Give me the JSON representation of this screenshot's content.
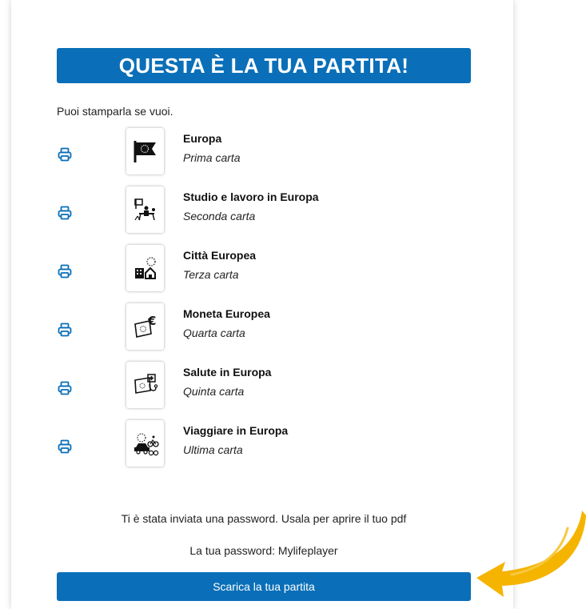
{
  "header": {
    "title": "QUESTA È LA TUA PARTITA!"
  },
  "intro": "Puoi stamparla se vuoi.",
  "cards": [
    {
      "title": "Europa",
      "subtitle": "Prima carta",
      "icon": "eu-flag-icon"
    },
    {
      "title": "Studio e lavoro in Europa",
      "subtitle": "Seconda carta",
      "icon": "study-work-icon"
    },
    {
      "title": "Città Europea",
      "subtitle": "Terza carta",
      "icon": "city-icon"
    },
    {
      "title": "Moneta Europea",
      "subtitle": "Quarta carta",
      "icon": "euro-flag-icon"
    },
    {
      "title": "Salute in Europa",
      "subtitle": "Quinta carta",
      "icon": "health-icon"
    },
    {
      "title": "Viaggiare in Europa",
      "subtitle": "Ultima carta",
      "icon": "travel-icon"
    }
  ],
  "notice": {
    "password_sent": "Ti è stata inviata una password. Usala per aprire il tuo pdf",
    "password_line": "La tua password: Mylifeplayer"
  },
  "download_button": "Scarica la tua partita",
  "colors": {
    "accent": "#0a6fb8",
    "arrow": "#f5b400"
  }
}
